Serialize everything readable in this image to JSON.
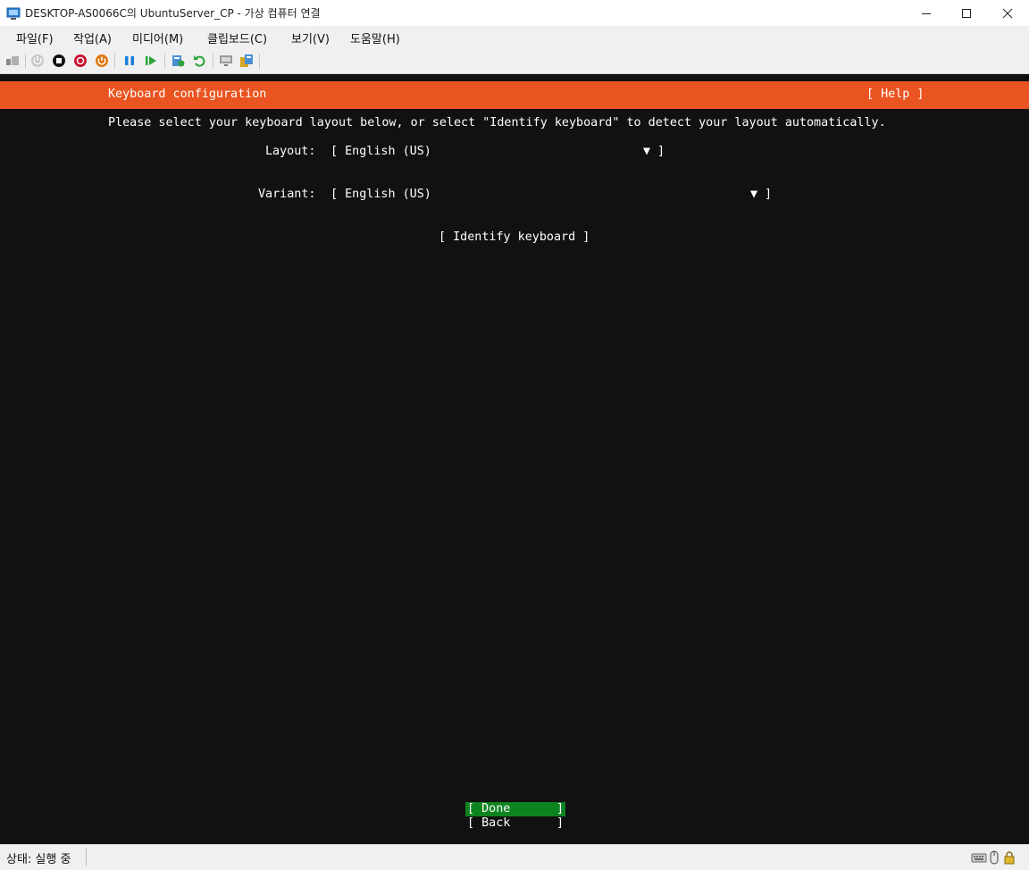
{
  "window": {
    "title": "DESKTOP-AS0066C의 UbuntuServer_CP - 가상 컴퓨터 연결",
    "app_icon": "vm-connection-icon",
    "controls": [
      "minimize-icon",
      "maximize-icon",
      "close-icon"
    ]
  },
  "menubar": {
    "items": [
      {
        "label": "파일(F)"
      },
      {
        "label": "작업(A)"
      },
      {
        "label": "미디어(M)"
      },
      {
        "label": "클립보드(C)"
      },
      {
        "label": "보기(V)"
      },
      {
        "label": "도움말(H)"
      }
    ]
  },
  "toolbar": {
    "buttons": [
      "ctrl-alt-del-icon",
      "start-icon",
      "turn-off-icon",
      "shutdown-icon",
      "power-icon",
      "pause-icon",
      "resume-icon",
      "checkpoint-icon",
      "revert-icon",
      "enhanced-session-icon",
      "share-icon"
    ],
    "colors": {
      "blue": "#1a7fd6",
      "green": "#2aa33a",
      "red": "#c8102e",
      "orange": "#e0760e"
    }
  },
  "installer": {
    "header": {
      "title": "Keyboard configuration",
      "help": "[ Help ]"
    },
    "instructions": "Please select your keyboard layout below, or select \"Identify keyboard\" to detect your layout automatically.",
    "layout": {
      "label": "Layout:",
      "value": "[ English (US)",
      "arrow": "▼",
      "close": "]"
    },
    "variant": {
      "label": "Variant:",
      "value": "[ English (US)",
      "arrow": "▼",
      "close": "]"
    },
    "identify_button": "[ Identify keyboard ]",
    "done_button": {
      "open": "[ Done",
      "close": "]"
    },
    "back_button": {
      "open": "[ Back",
      "close": "]"
    },
    "colors": {
      "header_bg": "#e95420",
      "screen_bg": "#111111",
      "done_bg": "#0e8420",
      "text": "#ffffff"
    }
  },
  "statusbar": {
    "status": "상태: 실행 중",
    "icons": [
      "keyboard-icon",
      "mouse-icon",
      "lock-icon"
    ]
  }
}
